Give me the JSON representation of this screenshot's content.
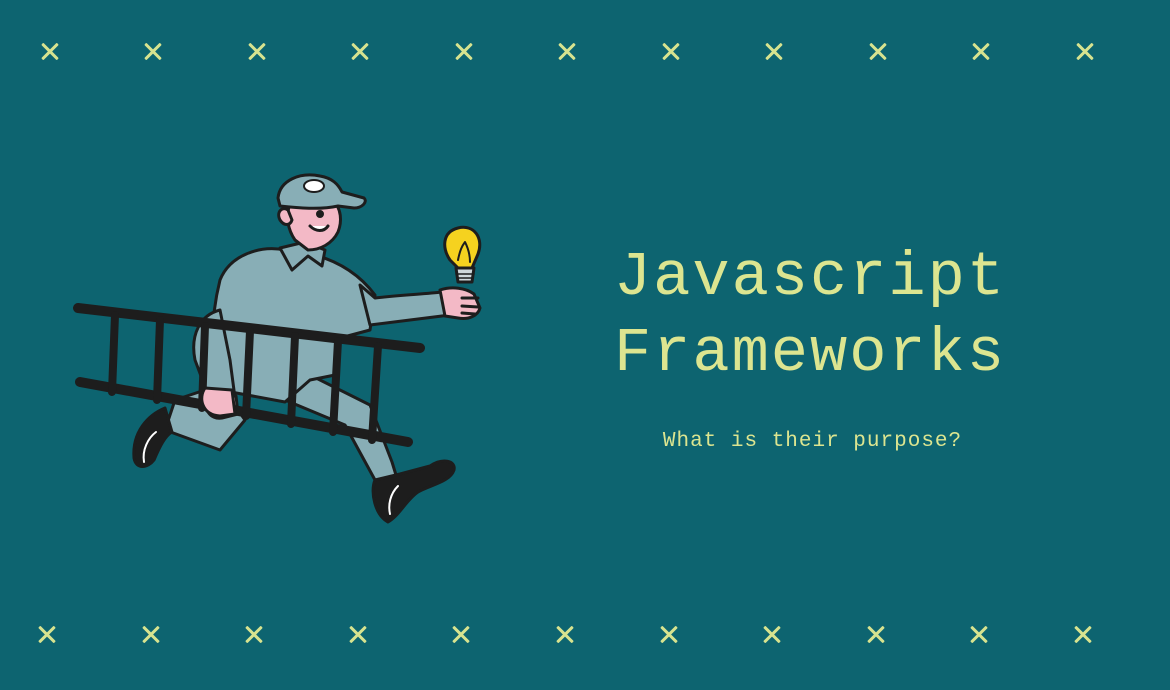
{
  "heading": {
    "line1": "Javascript",
    "line2": "Frameworks"
  },
  "subheading": "What is their purpose?",
  "decorations": {
    "mark_glyph": "x-icon",
    "marks_per_row": 11
  },
  "illustration": {
    "subject": "cartoon-handyman-with-ladder-and-lightbulb"
  },
  "colors": {
    "background": "#0d6470",
    "accent": "#dce590",
    "uniform": "#88aeb6",
    "skin": "#f3b9c6",
    "bulb": "#f5d21f",
    "ladder": "#1d1d1d"
  }
}
